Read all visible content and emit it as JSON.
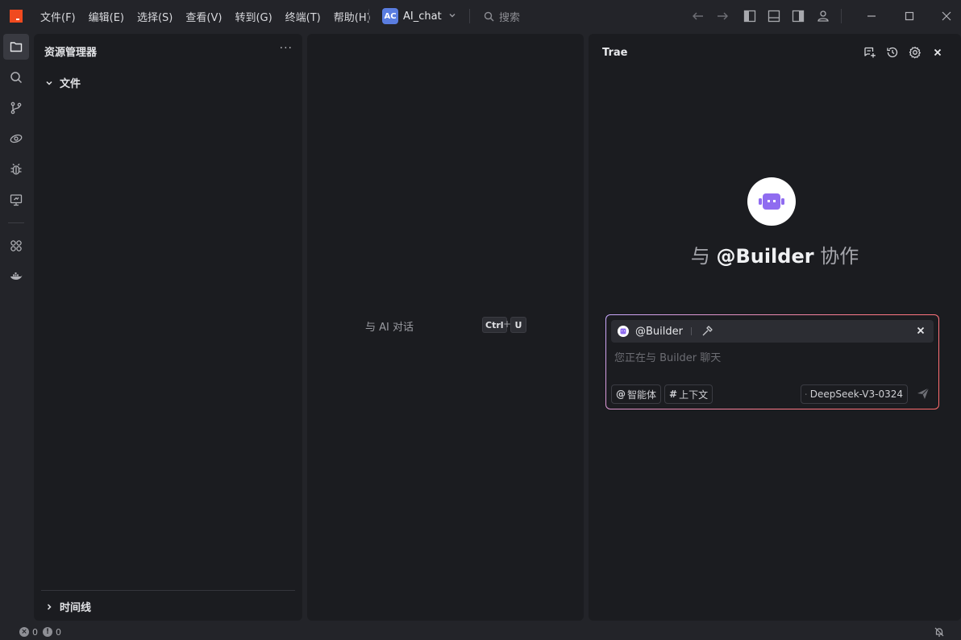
{
  "titlebar": {
    "menu": [
      "文件(F)",
      "编辑(E)",
      "选择(S)",
      "查看(V)",
      "转到(G)",
      "终端(T)",
      "帮助(H)"
    ],
    "project_badge": "AC",
    "project_name": "AI_chat",
    "search_placeholder": "搜索"
  },
  "explorer": {
    "title": "资源管理器",
    "more": "···",
    "files_section": "文件",
    "timeline_section": "时间线"
  },
  "editor": {
    "hint_label": "与 AI 对话",
    "shortcut_key1": "Ctrl",
    "shortcut_plus": "+",
    "shortcut_key2": "U"
  },
  "chat": {
    "title": "Trae",
    "collab_prefix": "与 ",
    "collab_agent": "@Builder",
    "collab_suffix": " 协作",
    "agent_chip_name": "@Builder",
    "input_placeholder": "您正在与 Builder 聊天",
    "pill_agent": "智能体",
    "pill_context": "上下文",
    "model_name": "DeepSeek-V3-0324"
  },
  "statusbar": {
    "errors": "0",
    "warnings": "0"
  },
  "colors": {
    "accent_logo": "#f04a1f",
    "project_badge": "#5a7de0",
    "bot_purple": "#8f6cf0"
  }
}
